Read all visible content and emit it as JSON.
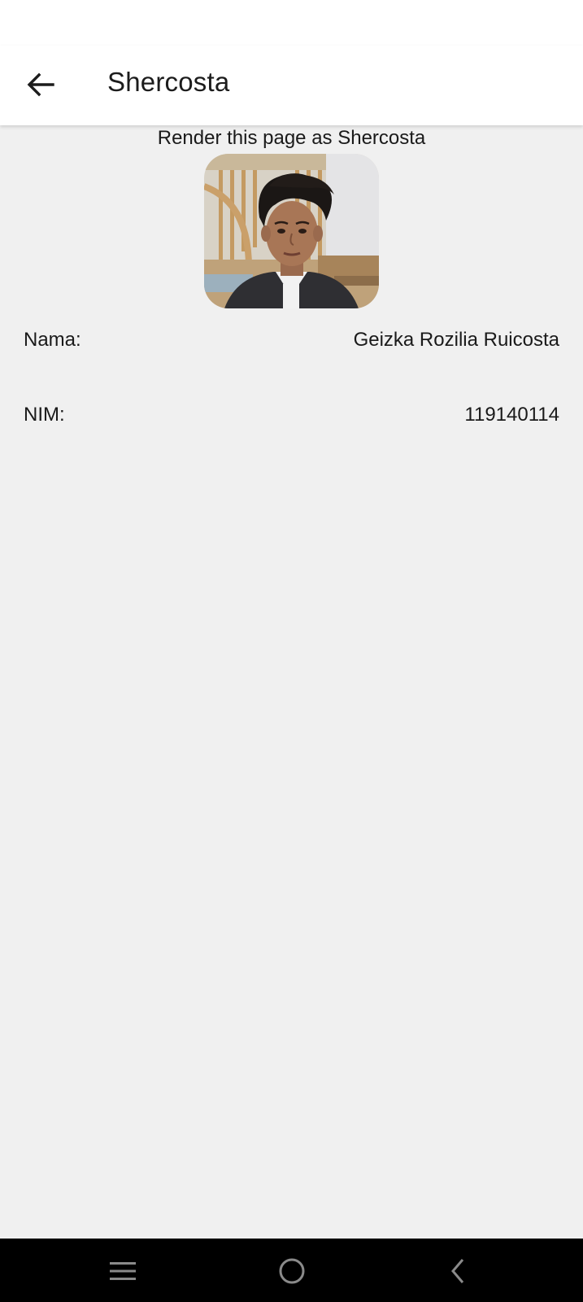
{
  "app_bar": {
    "title": "Shercosta",
    "back_icon": "arrow-left-icon"
  },
  "profile": {
    "subtitle": "Render this page as Shercosta",
    "photo_icon": "profile-photo",
    "fields": [
      {
        "label": "Nama:",
        "value": "Geizka Rozilia Ruicosta"
      },
      {
        "label": "NIM:",
        "value": "119140114"
      }
    ]
  },
  "nav_bar": {
    "recents_icon": "menu-lines-icon",
    "home_icon": "circle-home-icon",
    "back_icon": "chevron-left-icon"
  },
  "colors": {
    "background": "#f0f0f0",
    "app_bar": "#ffffff",
    "nav_bar": "#000000",
    "text": "#1a1a1a"
  }
}
